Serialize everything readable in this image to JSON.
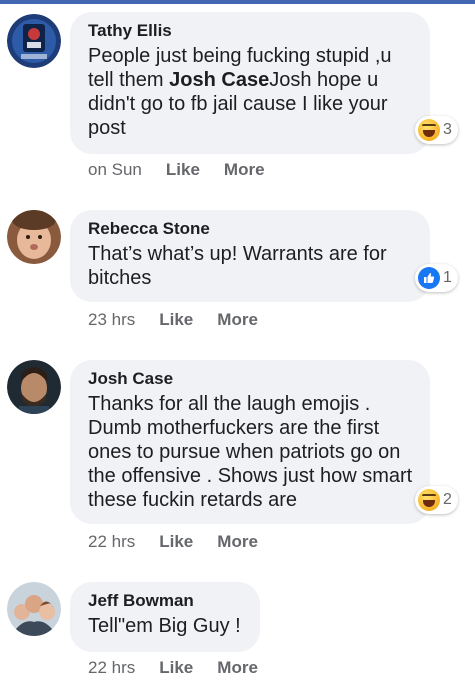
{
  "comments": [
    {
      "author": "Tathy Ellis",
      "text_before": "People just being fucking stupid ,u tell them ",
      "mention": "Josh Case",
      "text_after": "Josh hope u didn't go to fb jail cause I like your post",
      "reaction": {
        "type": "haha-icon",
        "count": "3"
      },
      "time": "on Sun",
      "like_label": "Like",
      "more_label": "More"
    },
    {
      "author": "Rebecca Stone",
      "text": "That’s what’s up! Warrants are for bitches",
      "reaction": {
        "type": "like-icon",
        "count": "1"
      },
      "time": "23 hrs",
      "like_label": "Like",
      "more_label": "More"
    },
    {
      "author": "Josh Case",
      "text": "Thanks for all the laugh emojis . Dumb motherfuckers are the first ones to pursue when patriots go on the offensive . Shows just how smart these fuckin retards are",
      "reaction": {
        "type": "haha-icon",
        "count": "2"
      },
      "time": "22 hrs",
      "like_label": "Like",
      "more_label": "More"
    },
    {
      "author": "Jeff Bowman",
      "text": "Tell\"em Big Guy !",
      "time": "22 hrs",
      "like_label": "Like",
      "more_label": "More"
    }
  ],
  "colors": {
    "bubble": "#f0f2f5",
    "meta": "#65676b",
    "like_blue": "#1877f2",
    "top_bar": "#4267b2"
  }
}
